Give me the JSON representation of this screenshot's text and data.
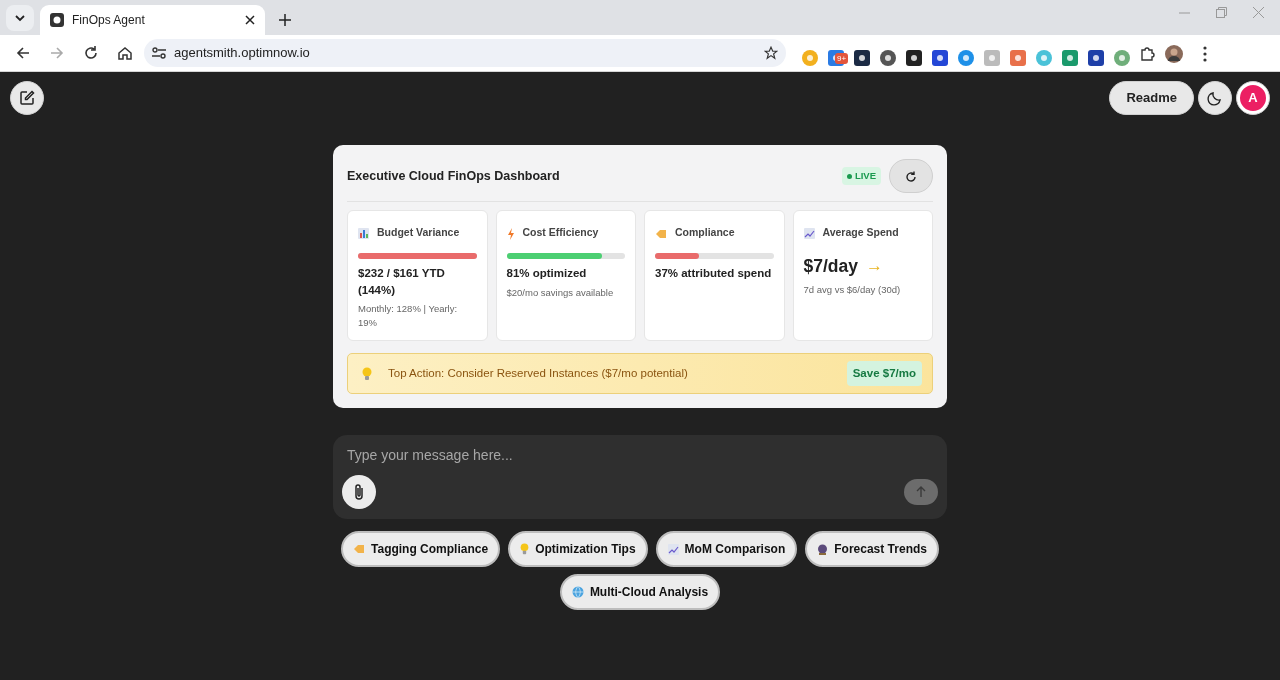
{
  "browser": {
    "tab_title": "FinOps Agent",
    "url": "agentsmith.optimnow.io",
    "extension_badge": "9+"
  },
  "header": {
    "readme": "Readme",
    "avatar": "A"
  },
  "dashboard": {
    "title": "Executive Cloud FinOps Dashboard",
    "live": "LIVE",
    "metrics": [
      {
        "kind": "bar",
        "title": "Budget Variance",
        "level": 1.0,
        "color": "#e96b6b",
        "value": "$232 / $161 YTD (144%)",
        "note": "Monthly: 128% | Yearly: 19%"
      },
      {
        "kind": "bar",
        "title": "Cost Efficiency",
        "level": 0.81,
        "color": "#4ccf72",
        "value": "81% optimized",
        "note": "$20/mo savings available"
      },
      {
        "kind": "bar",
        "title": "Compliance",
        "level": 0.37,
        "color": "#e96b6b",
        "value": "37% attributed spend"
      },
      {
        "kind": "trend",
        "title": "Average Spend",
        "value": "$7/day",
        "arrow": "→",
        "note": "7d avg vs $6/day (30d)"
      }
    ],
    "action": {
      "text": "Top Action: Consider Reserved Instances ($7/mo potential)",
      "save": "Save $7/mo"
    }
  },
  "composer": {
    "placeholder": "Type your message here..."
  },
  "suggestions": [
    {
      "label": "Tagging Compliance"
    },
    {
      "label": "Optimization Tips"
    },
    {
      "label": "MoM Comparison"
    },
    {
      "label": "Forecast Trends"
    },
    {
      "label": "Multi-Cloud Analysis"
    }
  ]
}
